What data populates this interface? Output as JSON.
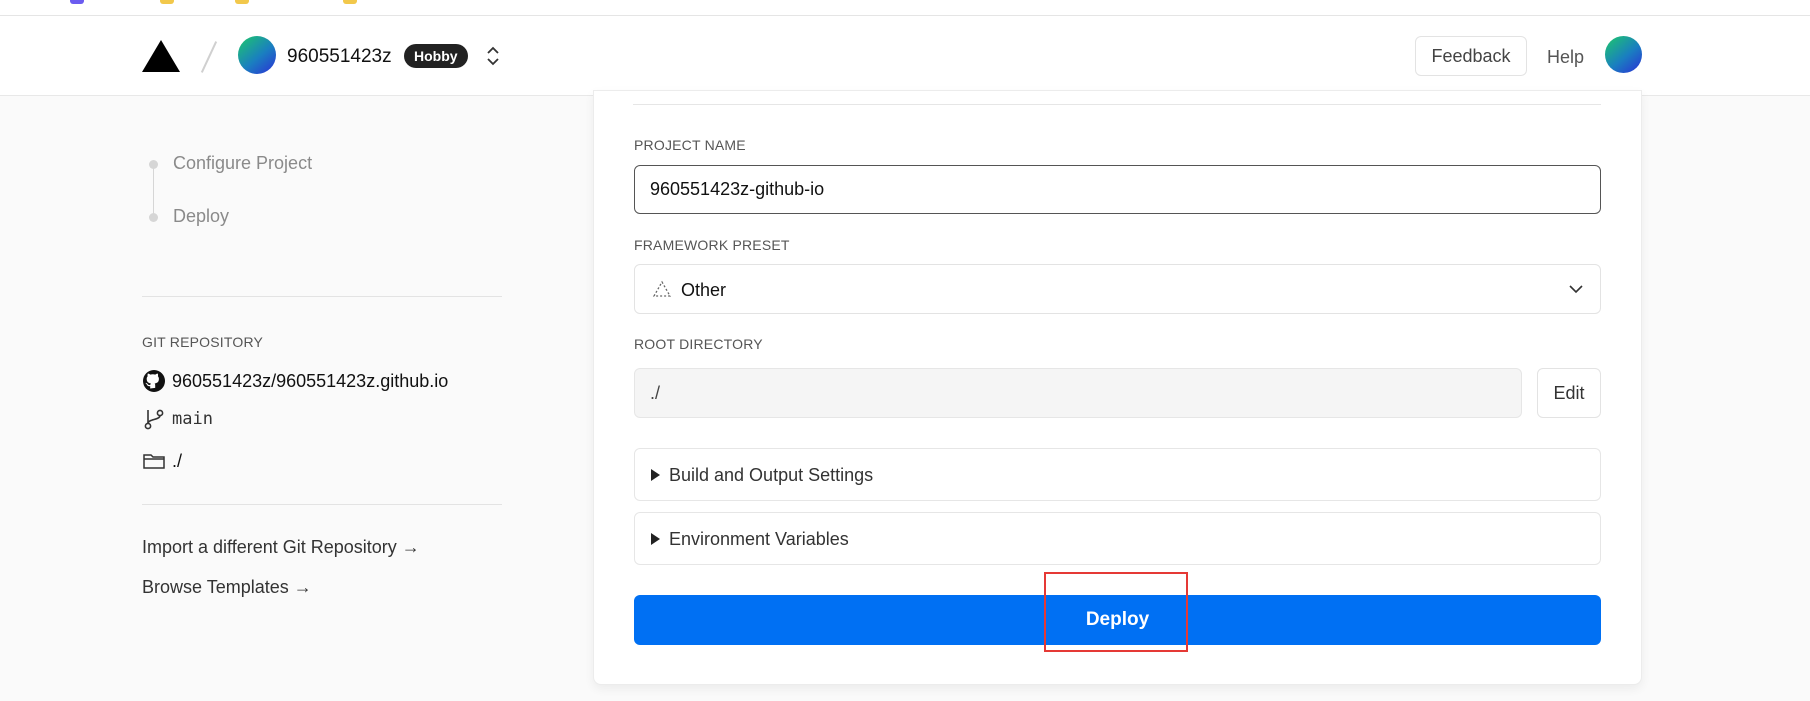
{
  "header": {
    "team_name": "960551423z",
    "plan_badge": "Hobby",
    "feedback_label": "Feedback",
    "help_label": "Help"
  },
  "steps": [
    {
      "label": "Configure Project"
    },
    {
      "label": "Deploy"
    }
  ],
  "git": {
    "section_title": "GIT REPOSITORY",
    "repository": "960551423z/960551423z.github.io",
    "branch": "main",
    "directory": "./"
  },
  "links": {
    "import_label": "Import a different Git Repository →",
    "templates_label": "Browse Templates →"
  },
  "form": {
    "project_name_label": "PROJECT NAME",
    "project_name_value": "960551423z-github-io",
    "framework_label": "FRAMEWORK PRESET",
    "framework_value": "Other",
    "root_label": "ROOT DIRECTORY",
    "root_value": "./",
    "edit_label": "Edit",
    "build_settings_label": "Build and Output Settings",
    "env_vars_label": "Environment Variables",
    "deploy_label": "Deploy"
  },
  "colors": {
    "accent": "#0070f3",
    "highlight": "#e53935",
    "badge_bg": "#222222"
  },
  "icons": [
    "vercel-logo-icon",
    "chevron-updown-icon",
    "github-icon",
    "git-branch-icon",
    "folder-icon",
    "framework-triangle-icon",
    "chevron-down-icon",
    "caret-right-icon"
  ]
}
